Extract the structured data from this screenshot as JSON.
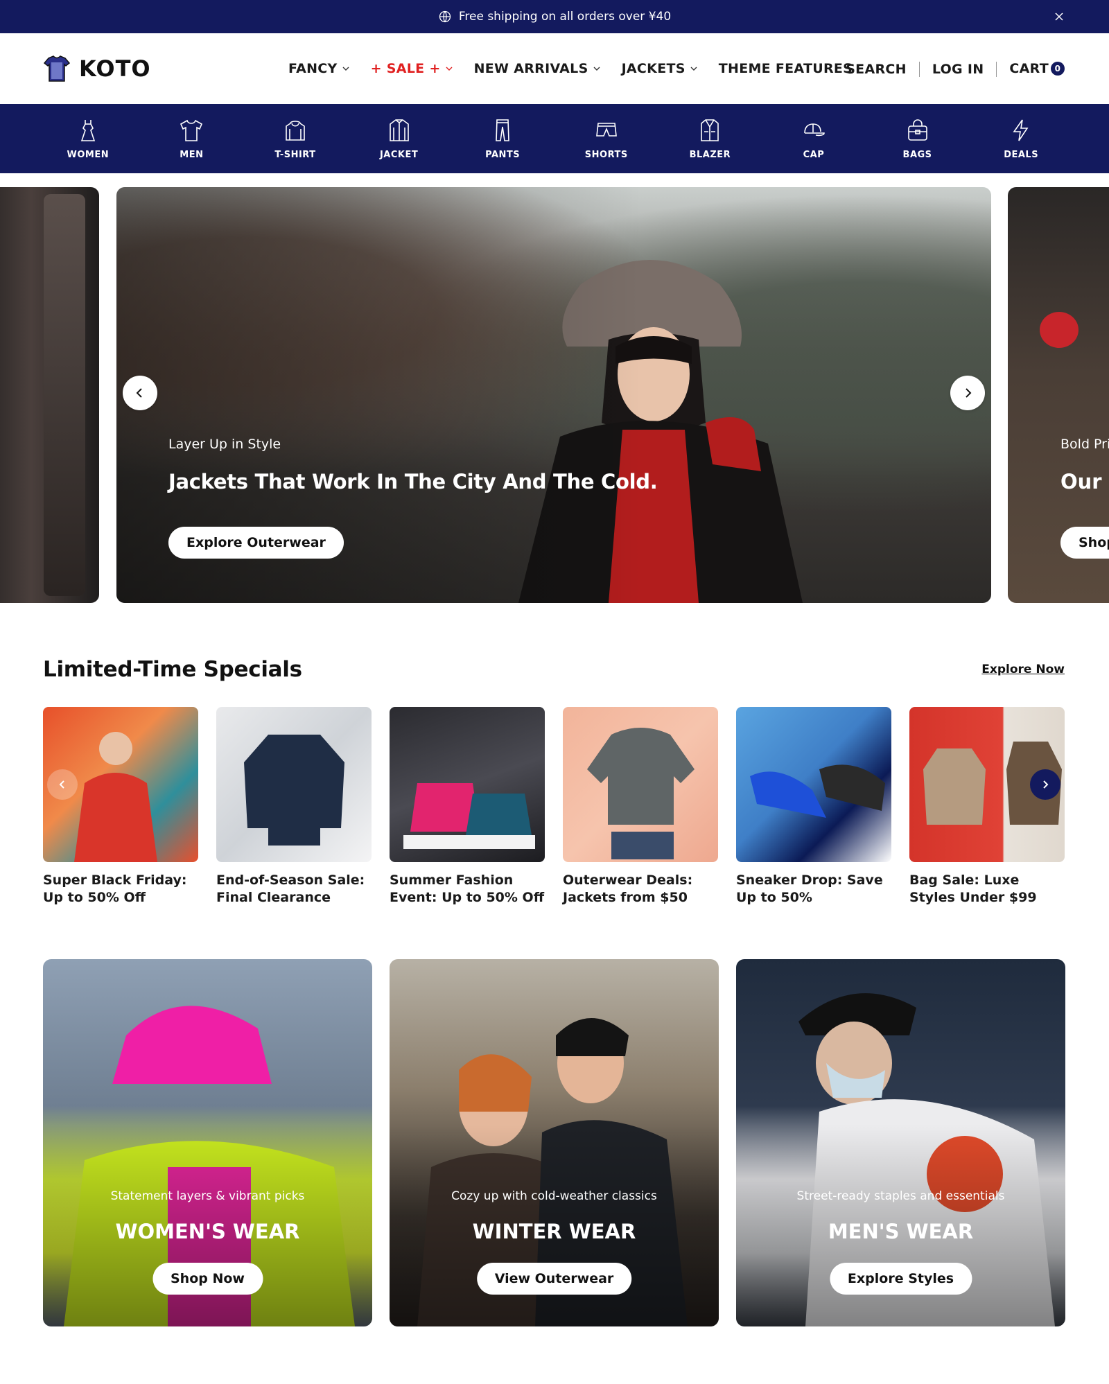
{
  "announcement": {
    "text": "Free shipping on all orders over ¥40"
  },
  "header": {
    "logo": "KOTO",
    "nav": [
      {
        "label": "FANCY",
        "dropdown": true,
        "sale": false
      },
      {
        "label": "+ SALE +",
        "dropdown": true,
        "sale": true
      },
      {
        "label": "NEW ARRIVALS",
        "dropdown": true,
        "sale": false
      },
      {
        "label": "JACKETS",
        "dropdown": true,
        "sale": false
      },
      {
        "label": "THEME FEATURES",
        "dropdown": false,
        "sale": false
      }
    ],
    "search": "SEARCH",
    "login": "LOG IN",
    "cart": "CART",
    "cart_count": "0"
  },
  "categories": [
    {
      "label": "WOMEN",
      "icon": "dress-icon"
    },
    {
      "label": "MEN",
      "icon": "tshirt-icon"
    },
    {
      "label": "T-SHIRT",
      "icon": "hoodie-icon"
    },
    {
      "label": "JACKET",
      "icon": "jacket-icon"
    },
    {
      "label": "PANTS",
      "icon": "pants-icon"
    },
    {
      "label": "SHORTS",
      "icon": "shorts-icon"
    },
    {
      "label": "BLAZER",
      "icon": "blazer-icon"
    },
    {
      "label": "CAP",
      "icon": "cap-icon"
    },
    {
      "label": "BAGS",
      "icon": "bag-icon"
    },
    {
      "label": "DEALS",
      "icon": "lightning-icon"
    }
  ],
  "hero": {
    "main": {
      "subtitle": "Layer Up in Style",
      "title": "Jackets That Work In The City And The Cold.",
      "button": "Explore Outerwear"
    },
    "next": {
      "subtitle": "Bold Pri",
      "title": "Our C",
      "button": "Shop"
    }
  },
  "specials": {
    "title": "Limited-Time Specials",
    "link": "Explore Now",
    "items": [
      {
        "label": "Super Black Friday: Up to 50% Off"
      },
      {
        "label": "End-of-Season Sale: Final Clearance"
      },
      {
        "label": "Summer Fashion Event: Up to 50% Off"
      },
      {
        "label": "Outerwear Deals: Jackets from $50"
      },
      {
        "label": "Sneaker Drop: Save Up to 50%"
      },
      {
        "label": "Bag Sale: Luxe Styles Under $99"
      }
    ]
  },
  "tiles": [
    {
      "subtitle": "Statement layers & vibrant picks",
      "title": "WOMEN'S WEAR",
      "button": "Shop Now"
    },
    {
      "subtitle": "Cozy up with cold-weather classics",
      "title": "WINTER WEAR",
      "button": "View Outerwear"
    },
    {
      "subtitle": "Street-ready staples and essentials",
      "title": "MEN'S WEAR",
      "button": "Explore Styles"
    }
  ],
  "colors": {
    "brand_navy": "#131a5e",
    "sale_red": "#e02020"
  }
}
